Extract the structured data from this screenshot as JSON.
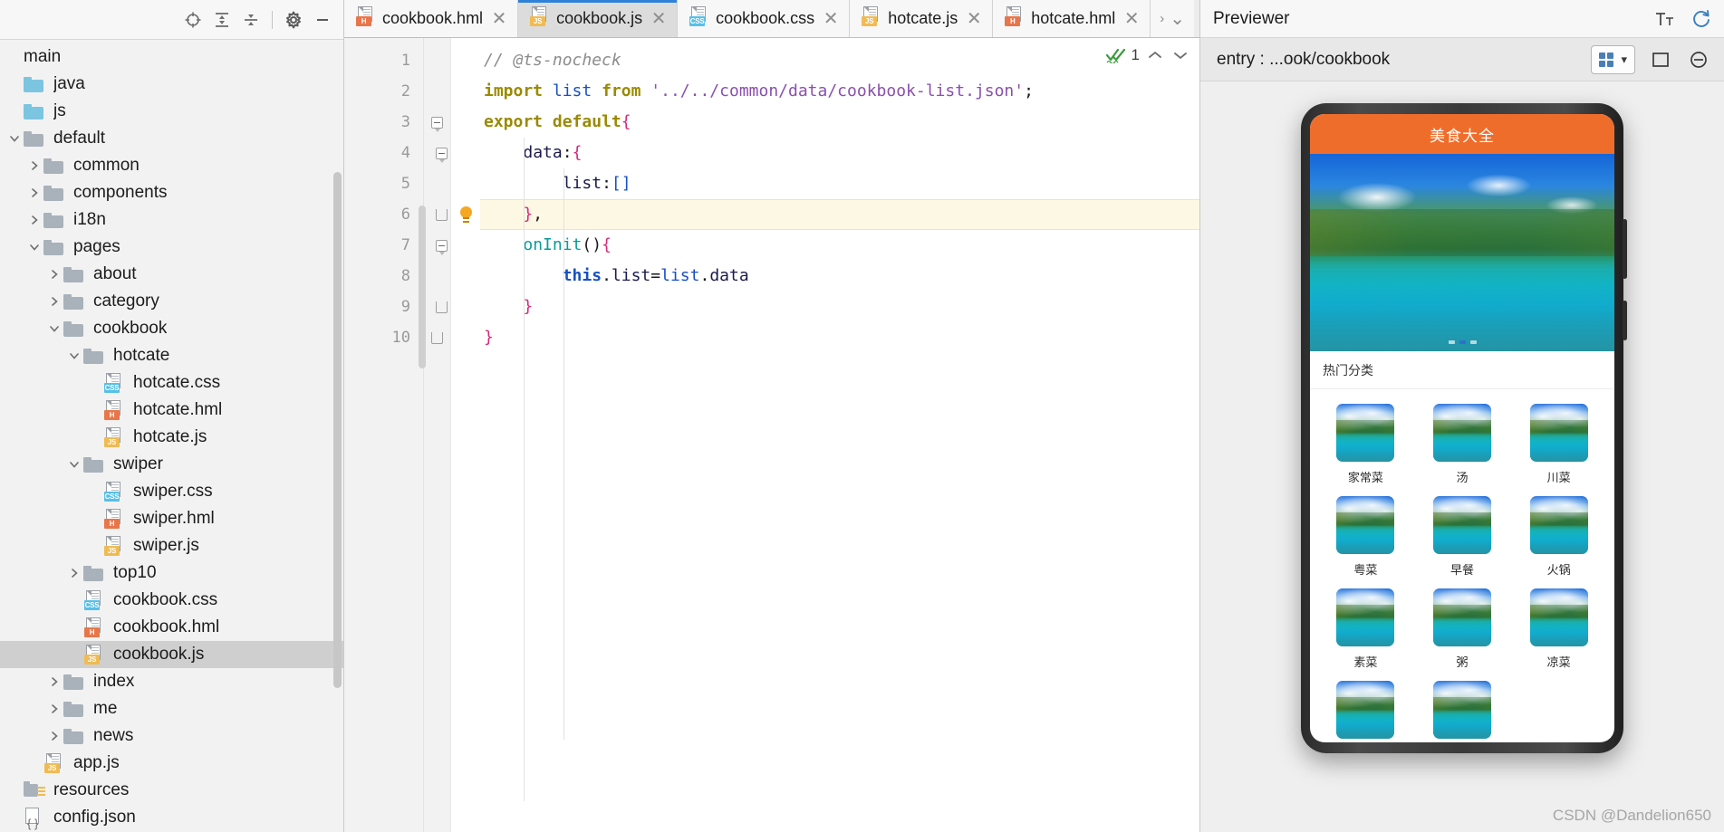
{
  "project_panel": {
    "toolbar": {
      "locate_label": "locate-icon",
      "expand_all_label": "expand-all-icon",
      "collapse_all_label": "collapse-all-icon",
      "settings_label": "gear-icon",
      "minimize_label": "minimize-icon"
    },
    "tree": [
      {
        "label": "main",
        "depth": 0,
        "kind": "plain",
        "arrow": "none",
        "selected": false
      },
      {
        "label": "java",
        "depth": 0,
        "kind": "folder-blue",
        "arrow": "none",
        "selected": false
      },
      {
        "label": "js",
        "depth": 0,
        "kind": "folder-blue",
        "arrow": "none",
        "selected": false
      },
      {
        "label": "default",
        "depth": 0,
        "kind": "folder-grey",
        "arrow": "expanded",
        "selected": false
      },
      {
        "label": "common",
        "depth": 1,
        "kind": "folder-grey",
        "arrow": "collapsed",
        "selected": false
      },
      {
        "label": "components",
        "depth": 1,
        "kind": "folder-grey",
        "arrow": "collapsed",
        "selected": false
      },
      {
        "label": "i18n",
        "depth": 1,
        "kind": "folder-grey",
        "arrow": "collapsed",
        "selected": false
      },
      {
        "label": "pages",
        "depth": 1,
        "kind": "folder-grey",
        "arrow": "expanded",
        "selected": false
      },
      {
        "label": "about",
        "depth": 2,
        "kind": "folder-grey",
        "arrow": "collapsed",
        "selected": false
      },
      {
        "label": "category",
        "depth": 2,
        "kind": "folder-grey",
        "arrow": "collapsed",
        "selected": false
      },
      {
        "label": "cookbook",
        "depth": 2,
        "kind": "folder-grey",
        "arrow": "expanded",
        "selected": false
      },
      {
        "label": "hotcate",
        "depth": 3,
        "kind": "folder-grey",
        "arrow": "expanded",
        "selected": false
      },
      {
        "label": "hotcate.css",
        "depth": 4,
        "kind": "file-css",
        "arrow": "none",
        "selected": false
      },
      {
        "label": "hotcate.hml",
        "depth": 4,
        "kind": "file-h",
        "arrow": "none",
        "selected": false
      },
      {
        "label": "hotcate.js",
        "depth": 4,
        "kind": "file-js",
        "arrow": "none",
        "selected": false
      },
      {
        "label": "swiper",
        "depth": 3,
        "kind": "folder-grey",
        "arrow": "expanded",
        "selected": false
      },
      {
        "label": "swiper.css",
        "depth": 4,
        "kind": "file-css",
        "arrow": "none",
        "selected": false
      },
      {
        "label": "swiper.hml",
        "depth": 4,
        "kind": "file-h",
        "arrow": "none",
        "selected": false
      },
      {
        "label": "swiper.js",
        "depth": 4,
        "kind": "file-js",
        "arrow": "none",
        "selected": false
      },
      {
        "label": "top10",
        "depth": 3,
        "kind": "folder-grey",
        "arrow": "collapsed",
        "selected": false
      },
      {
        "label": "cookbook.css",
        "depth": 3,
        "kind": "file-css",
        "arrow": "none",
        "selected": false
      },
      {
        "label": "cookbook.hml",
        "depth": 3,
        "kind": "file-h",
        "arrow": "none",
        "selected": false
      },
      {
        "label": "cookbook.js",
        "depth": 3,
        "kind": "file-js",
        "arrow": "none",
        "selected": true
      },
      {
        "label": "index",
        "depth": 2,
        "kind": "folder-grey",
        "arrow": "collapsed",
        "selected": false
      },
      {
        "label": "me",
        "depth": 2,
        "kind": "folder-grey",
        "arrow": "collapsed",
        "selected": false
      },
      {
        "label": "news",
        "depth": 2,
        "kind": "folder-grey",
        "arrow": "collapsed",
        "selected": false
      },
      {
        "label": "app.js",
        "depth": 1,
        "kind": "file-js",
        "arrow": "none",
        "selected": false
      },
      {
        "label": "resources",
        "depth": 0,
        "kind": "resources",
        "arrow": "none",
        "selected": false
      },
      {
        "label": "config.json",
        "depth": 0,
        "kind": "file-json",
        "arrow": "none",
        "selected": false
      }
    ]
  },
  "editor": {
    "tabs": [
      {
        "label": "cookbook.hml",
        "icon": "file-h",
        "active": false
      },
      {
        "label": "cookbook.js",
        "icon": "file-js",
        "active": true
      },
      {
        "label": "cookbook.css",
        "icon": "file-css",
        "active": false
      },
      {
        "label": "hotcate.js",
        "icon": "file-js",
        "active": false
      },
      {
        "label": "hotcate.hml",
        "icon": "file-h",
        "active": false
      }
    ],
    "tab_close_glyph": "✕",
    "tab_overflow_glyph": "›",
    "tab_dropdown_glyph": "⌄",
    "line_numbers": [
      "1",
      "2",
      "3",
      "4",
      "5",
      "6",
      "7",
      "8",
      "9",
      "10"
    ],
    "inspection": {
      "count": "1",
      "ok_icon": "double-check-icon",
      "prev_glyph": "⌃",
      "next_glyph": "⌄"
    },
    "code_lines": [
      {
        "n": 1,
        "hl": false,
        "fold": "none",
        "bulb": false,
        "tokens": [
          {
            "t": "// @ts-nocheck",
            "c": "k-comment",
            "squiggle": true
          }
        ]
      },
      {
        "n": 2,
        "hl": false,
        "fold": "none",
        "bulb": false,
        "tokens": [
          {
            "t": "import",
            "c": "k-kw"
          },
          {
            "t": " ",
            "c": "k-plain"
          },
          {
            "t": "list",
            "c": "k-kw2"
          },
          {
            "t": " ",
            "c": "k-plain"
          },
          {
            "t": "from",
            "c": "k-kw"
          },
          {
            "t": " ",
            "c": "k-plain"
          },
          {
            "t": "'../../common/data/cookbook-list.json'",
            "c": "k-str"
          },
          {
            "t": ";",
            "c": "k-plain"
          }
        ]
      },
      {
        "n": 3,
        "hl": false,
        "fold": "top",
        "bulb": false,
        "tokens": [
          {
            "t": "export",
            "c": "k-kw"
          },
          {
            "t": " ",
            "c": "k-plain"
          },
          {
            "t": "default",
            "c": "k-kw"
          },
          {
            "t": "{",
            "c": "k-brace"
          }
        ]
      },
      {
        "n": 4,
        "hl": false,
        "fold": "mid",
        "bulb": false,
        "tokens": [
          {
            "t": "    ",
            "c": "k-plain"
          },
          {
            "t": "data",
            "c": "k-prop"
          },
          {
            "t": ":",
            "c": "k-plain"
          },
          {
            "t": "{",
            "c": "k-brace"
          }
        ]
      },
      {
        "n": 5,
        "hl": false,
        "fold": "none",
        "bulb": false,
        "tokens": [
          {
            "t": "        ",
            "c": "k-plain"
          },
          {
            "t": "list",
            "c": "k-prop"
          },
          {
            "t": ":",
            "c": "k-plain"
          },
          {
            "t": "[]",
            "c": "k-brk"
          }
        ]
      },
      {
        "n": 6,
        "hl": true,
        "fold": "end",
        "bulb": true,
        "tokens": [
          {
            "t": "    ",
            "c": "k-plain"
          },
          {
            "t": "}",
            "c": "k-brace"
          },
          {
            "t": ",",
            "c": "k-plain"
          }
        ]
      },
      {
        "n": 7,
        "hl": false,
        "fold": "mid",
        "bulb": false,
        "tokens": [
          {
            "t": "    ",
            "c": "k-plain"
          },
          {
            "t": "onInit",
            "c": "k-fn"
          },
          {
            "t": "()",
            "c": "k-plain"
          },
          {
            "t": "{",
            "c": "k-brace"
          }
        ]
      },
      {
        "n": 8,
        "hl": false,
        "fold": "none",
        "bulb": false,
        "tokens": [
          {
            "t": "        ",
            "c": "k-plain"
          },
          {
            "t": "this",
            "c": "k-this"
          },
          {
            "t": ".",
            "c": "k-plain"
          },
          {
            "t": "list",
            "c": "k-prop"
          },
          {
            "t": "=",
            "c": "k-plain"
          },
          {
            "t": "list",
            "c": "k-kw2"
          },
          {
            "t": ".",
            "c": "k-plain"
          },
          {
            "t": "data",
            "c": "k-prop"
          }
        ]
      },
      {
        "n": 9,
        "hl": false,
        "fold": "end",
        "bulb": false,
        "tokens": [
          {
            "t": "    ",
            "c": "k-plain"
          },
          {
            "t": "}",
            "c": "k-brace"
          }
        ]
      },
      {
        "n": 10,
        "hl": false,
        "fold": "end",
        "bulb": false,
        "tokens": [
          {
            "t": "}",
            "c": "k-brace"
          }
        ]
      }
    ]
  },
  "previewer": {
    "title": "Previewer",
    "entry_label": "entry : ...ook/cookbook",
    "title_actions": [
      {
        "name": "font-size-icon",
        "glyph": "Tt"
      },
      {
        "name": "refresh-icon",
        "glyph": "⟳"
      }
    ],
    "toolbar": {
      "device_select_name": "device-select",
      "multi_device_icon": "grid-icon",
      "dropdown_glyph": "▾",
      "tools": [
        {
          "name": "fit-screen-icon",
          "glyph": "⬚"
        },
        {
          "name": "zoom-out-icon",
          "glyph": "⊖"
        }
      ]
    },
    "phone": {
      "app_title": "美食大全",
      "section_title": "热门分类",
      "swiper_dots": [
        false,
        true,
        false
      ],
      "categories": [
        {
          "name": "家常菜"
        },
        {
          "name": "汤"
        },
        {
          "name": "川菜"
        },
        {
          "name": "粤菜"
        },
        {
          "name": "早餐"
        },
        {
          "name": "火锅"
        },
        {
          "name": "素菜"
        },
        {
          "name": "粥"
        },
        {
          "name": "凉菜"
        },
        {
          "name": ""
        },
        {
          "name": ""
        }
      ]
    }
  },
  "watermark": "CSDN @Dandelion650",
  "colors": {
    "accent_blue": "#2f82da",
    "app_header_orange": "#ef6d2b",
    "selection_grey": "#cfcfcf",
    "highlight_line": "#fdf8e3",
    "js_badge": "#f0bb52",
    "css_badge": "#56c0e8",
    "hml_badge": "#e8764a"
  }
}
